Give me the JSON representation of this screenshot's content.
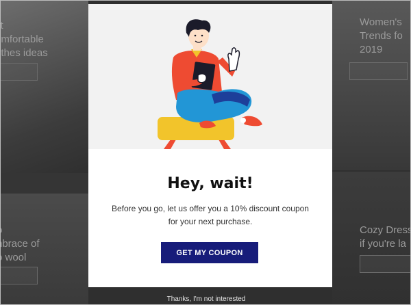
{
  "background": {
    "left_top_text": [
      "st",
      "omfortable",
      "othes ideas"
    ],
    "right_top_text": [
      "Women's",
      "Trends fo",
      "2019"
    ],
    "left_bottom_text": [
      "o",
      "nbrace of",
      "o wool"
    ],
    "right_bottom_text": [
      "Cozy Dress",
      "if you're la"
    ]
  },
  "modal": {
    "title": "Hey, wait!",
    "description": "Before you go, let us offer you a 10% discount coupon for your next purchase.",
    "cta_label": "GET MY COUPON",
    "cta_color": "#171c7a"
  },
  "dismiss_label": "Thanks, I'm not interested",
  "illustration": {
    "icon": "person-sitting-waving-illustration",
    "colors": {
      "shirt": "#ee4b32",
      "pants": "#2296d6",
      "stool": "#f2c42b",
      "skin": "#fde0c8",
      "hair": "#1b1b2a"
    }
  }
}
